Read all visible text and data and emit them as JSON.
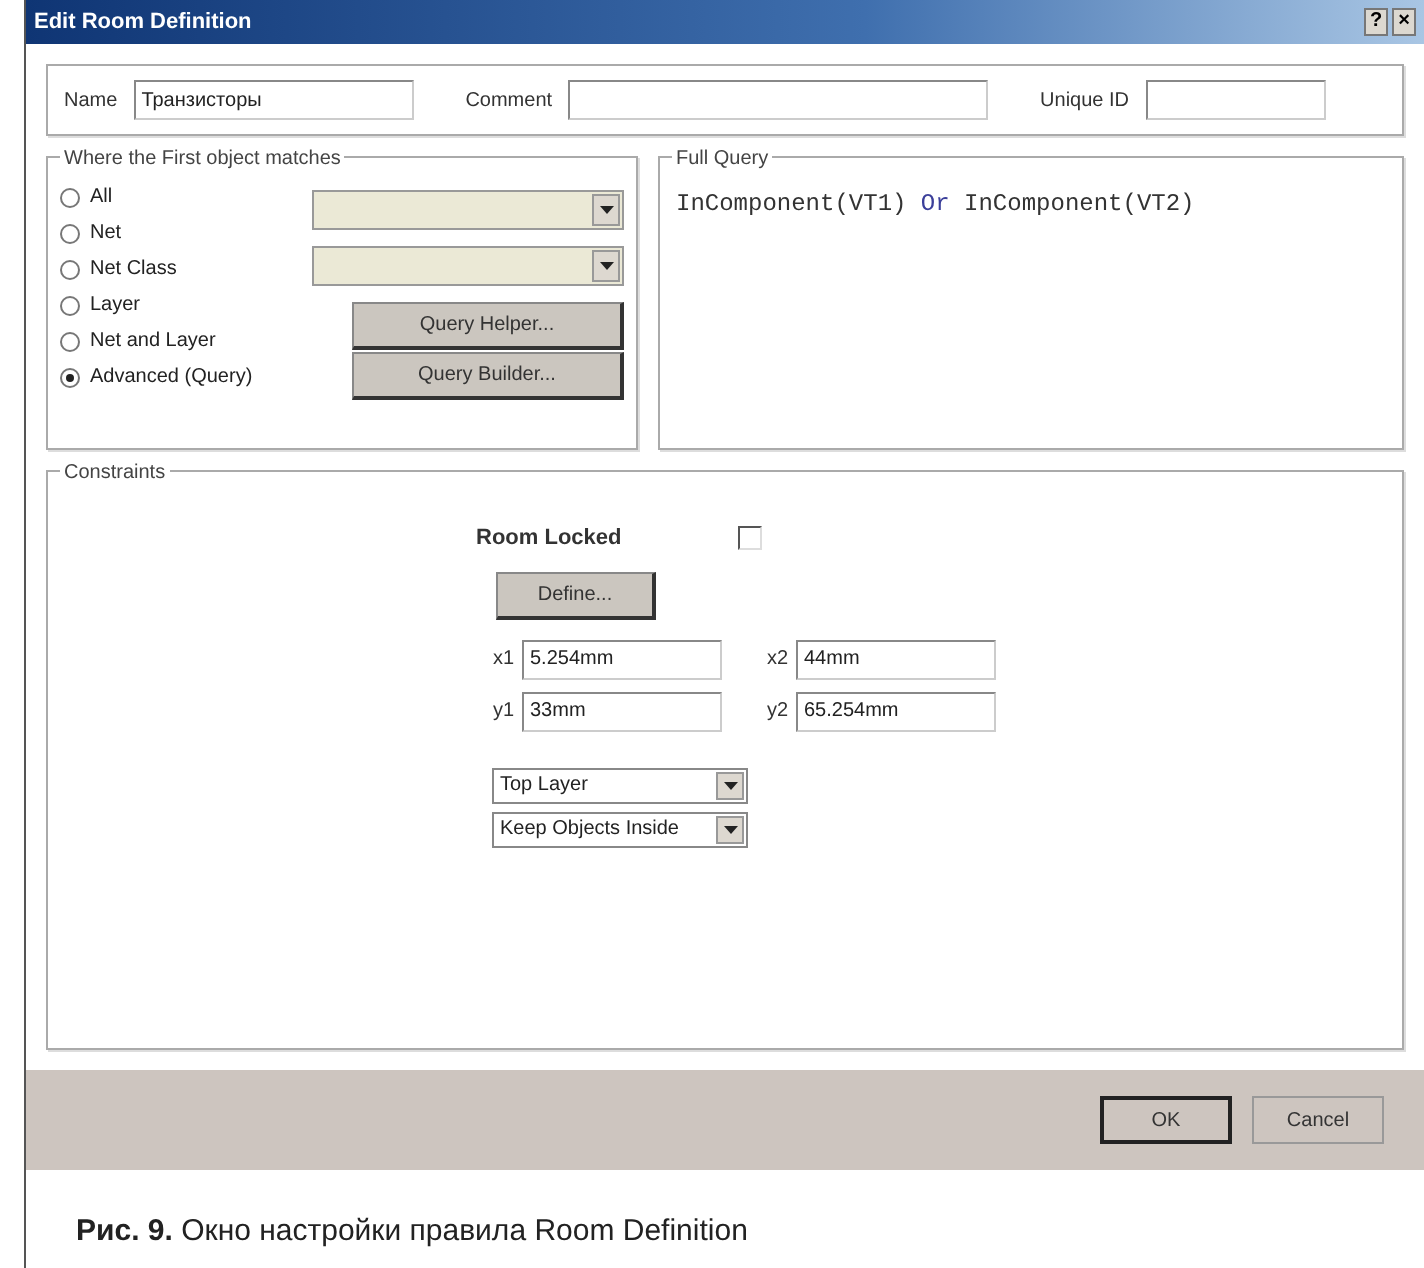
{
  "window": {
    "title": "Edit Room Definition",
    "help_button": "?",
    "close_button": "×"
  },
  "name_row": [
    {
      "label": "Name",
      "value": "Транзисторы"
    },
    {
      "label": "Comment"
    },
    {
      "label": "Unique ID"
    }
  ],
  "first_object": {
    "title": "Where the First object matches",
    "options": [
      {
        "label": "All",
        "selected": false
      },
      {
        "label": "Net",
        "selected": false
      },
      {
        "label": "Net Class",
        "selected": false
      },
      {
        "label": "Layer",
        "selected": false
      },
      {
        "label": "Net and Layer",
        "selected": false
      },
      {
        "label": "Advanced (Query)",
        "selected": true
      }
    ],
    "dropdowns": [
      {
        "disabled": true
      },
      {
        "disabled": true
      }
    ],
    "buttons": [
      "Query Helper...",
      "Query Builder..."
    ]
  },
  "full_query": {
    "title": "Full Query",
    "tokens": [
      {
        "text": "InComponent(VT1)",
        "kind": "code"
      },
      {
        "text": "Or",
        "kind": "keyword"
      },
      {
        "text": "InComponent(VT2)",
        "kind": "code"
      }
    ]
  },
  "constraints": {
    "title": "Constraints",
    "room_locked": {
      "label": "Room Locked",
      "checked": false
    },
    "define_button": "Define...",
    "coords": [
      {
        "label": "x1",
        "value": "5.254mm"
      },
      {
        "label": "x2",
        "value": "44mm"
      },
      {
        "label": "y1",
        "value": "33mm"
      },
      {
        "label": "y2",
        "value": "65.254mm"
      }
    ],
    "selects": [
      "Top Layer",
      "Keep Objects Inside"
    ]
  },
  "footer_buttons": [
    {
      "label": "OK",
      "default": true
    },
    {
      "label": "Cancel",
      "default": false
    }
  ],
  "caption": "**Рис. 9.** Окно настройки правила Room Definition"
}
